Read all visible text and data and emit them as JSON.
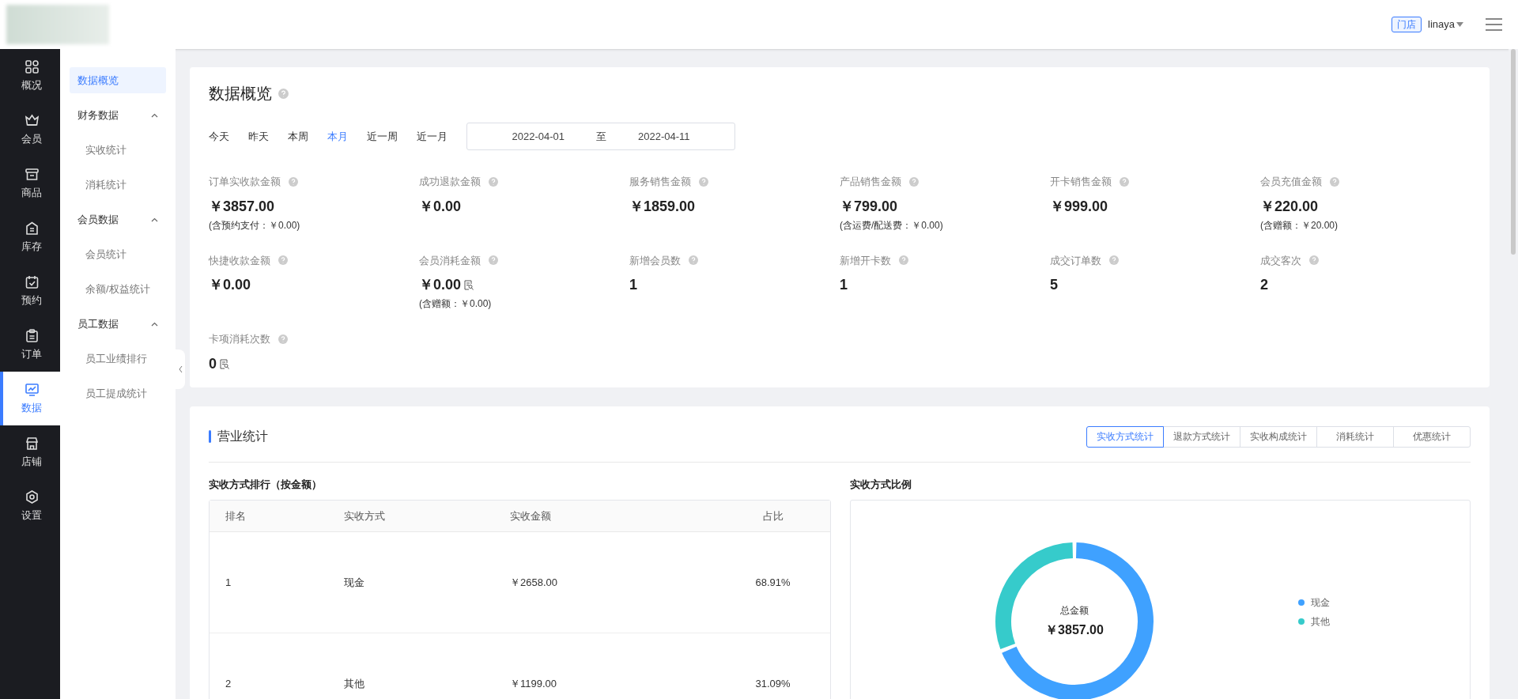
{
  "header": {
    "store_badge": "门店",
    "user": "linaya"
  },
  "rail": [
    {
      "label": "概况",
      "selected": false
    },
    {
      "label": "会员",
      "selected": false
    },
    {
      "label": "商品",
      "selected": false
    },
    {
      "label": "库存",
      "selected": false
    },
    {
      "label": "预约",
      "selected": false
    },
    {
      "label": "订单",
      "selected": false
    },
    {
      "label": "数据",
      "selected": true
    },
    {
      "label": "店铺",
      "selected": false
    },
    {
      "label": "设置",
      "selected": false
    }
  ],
  "subnav": [
    {
      "label": "数据概览",
      "selected": true
    },
    {
      "label": "财务数据",
      "selected": false,
      "expanded": true,
      "children": [
        {
          "label": "实收统计",
          "selected": false
        },
        {
          "label": "消耗统计",
          "selected": false
        }
      ]
    },
    {
      "label": "会员数据",
      "selected": false,
      "expanded": true,
      "children": [
        {
          "label": "会员统计",
          "selected": false
        },
        {
          "label": "余额/权益统计",
          "selected": false
        }
      ]
    },
    {
      "label": "员工数据",
      "selected": false,
      "expanded": true,
      "children": [
        {
          "label": "员工业绩排行",
          "selected": false
        },
        {
          "label": "员工提成统计",
          "selected": false
        }
      ]
    }
  ],
  "overview": {
    "title": "数据概览",
    "ranges": [
      {
        "label": "今天",
        "selected": false
      },
      {
        "label": "昨天",
        "selected": false
      },
      {
        "label": "本周",
        "selected": false
      },
      {
        "label": "本月",
        "selected": true
      },
      {
        "label": "近一周",
        "selected": false
      },
      {
        "label": "近一月",
        "selected": false
      }
    ],
    "date_range": {
      "start": "2022-04-01",
      "separator": "至",
      "end": "2022-04-11"
    },
    "metrics": [
      {
        "label": "订单实收款金额",
        "value": "￥3857.00",
        "note": "(含预约支付：￥0.00)",
        "detail": false
      },
      {
        "label": "成功退款金额",
        "value": "￥0.00",
        "detail": false
      },
      {
        "label": "服务销售金额",
        "value": "￥1859.00",
        "detail": false
      },
      {
        "label": "产品销售金额",
        "value": "￥799.00",
        "note": "(含运费/配送费：￥0.00)",
        "detail": false
      },
      {
        "label": "开卡销售金额",
        "value": "￥999.00",
        "detail": false
      },
      {
        "label": "会员充值金额",
        "value": "￥220.00",
        "note": "(含赠额：￥20.00)",
        "detail": false
      },
      {
        "label": "快捷收款金额",
        "value": "￥0.00",
        "detail": false
      },
      {
        "label": "会员消耗金额",
        "value": "￥0.00",
        "note": "(含赠额：￥0.00)",
        "detail": true
      },
      {
        "label": "新增会员数",
        "value": "1",
        "detail": false
      },
      {
        "label": "新增开卡数",
        "value": "1",
        "detail": false
      },
      {
        "label": "成交订单数",
        "value": "5",
        "detail": false
      },
      {
        "label": "成交客次",
        "value": "2",
        "detail": false
      },
      {
        "label": "卡项消耗次数",
        "value": "0",
        "detail": true
      }
    ]
  },
  "business": {
    "title": "营业统计",
    "tabs": [
      {
        "label": "实收方式统计",
        "selected": true
      },
      {
        "label": "退款方式统计",
        "selected": false
      },
      {
        "label": "实收构成统计",
        "selected": false
      },
      {
        "label": "消耗统计",
        "selected": false
      },
      {
        "label": "优惠统计",
        "selected": false
      }
    ],
    "table": {
      "title": "实收方式排行（按金额）",
      "columns": [
        "排名",
        "实收方式",
        "实收金额",
        "占比"
      ],
      "rows": [
        [
          "1",
          "现金",
          "￥2658.00",
          "68.91%"
        ],
        [
          "2",
          "其他",
          "￥1199.00",
          "31.09%"
        ]
      ]
    },
    "chart_panel": {
      "title": "实收方式比例",
      "center_label": "总金额",
      "center_value": "￥3857.00",
      "chart_data": {
        "type": "donut",
        "categories": [
          "现金",
          "其他"
        ],
        "values": [
          68.91,
          31.09
        ],
        "colors": [
          "#3fa1ff",
          "#36cbcb"
        ]
      }
    }
  }
}
